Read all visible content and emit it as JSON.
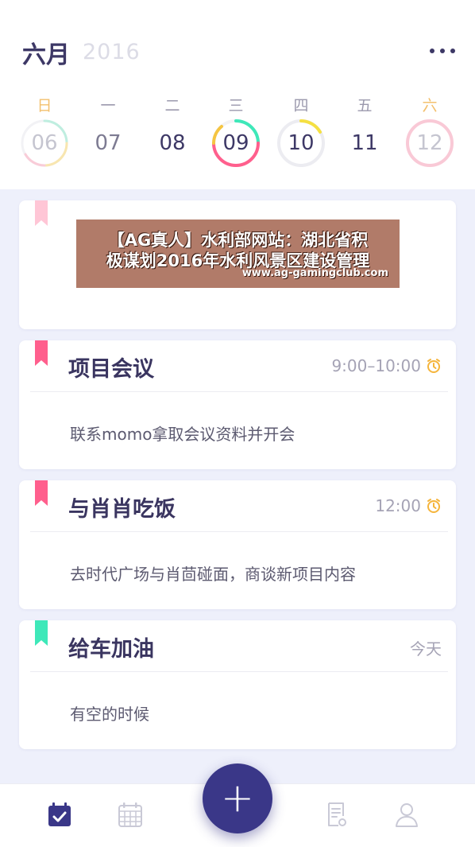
{
  "header": {
    "month": "六月",
    "year": "2016"
  },
  "weekdays": [
    "日",
    "一",
    "二",
    "三",
    "四",
    "五",
    "六"
  ],
  "days": [
    {
      "num": "06"
    },
    {
      "num": "07"
    },
    {
      "num": "08"
    },
    {
      "num": "09"
    },
    {
      "num": "10"
    },
    {
      "num": "11"
    },
    {
      "num": "12"
    }
  ],
  "ad": {
    "line1": "【AG真人】水利部网站：湖北省积",
    "line2": "极谋划2016年水利风景区建设管理",
    "url": "www.ag-gamingclub.com"
  },
  "tasks": [
    {
      "title": "项目会议",
      "time": "9:00–10:00",
      "desc": "联系momo拿取会议资料并开会",
      "tag_color": "#ff5f8d",
      "has_clock": true
    },
    {
      "title": "与肖肖吃饭",
      "time": "12:00",
      "desc": "去时代广场与肖茴碰面，商谈新项目内容",
      "tag_color": "#ff5f8d",
      "has_clock": true
    },
    {
      "title": "给车加油",
      "time": "今天",
      "desc": "有空的时候",
      "tag_color": "#3ee8b9",
      "has_clock": false
    }
  ],
  "colors": {
    "accent": "#3a3788",
    "pink": "#ff5f8d",
    "mint": "#3ee8b9",
    "yellow": "#f3c06e",
    "clock": "#f5b53c"
  },
  "tabbar": {
    "icons": [
      "calendar-check-icon",
      "calendar-grid-icon",
      "add-icon",
      "note-icon",
      "user-icon"
    ],
    "fab_symbol": "+"
  }
}
